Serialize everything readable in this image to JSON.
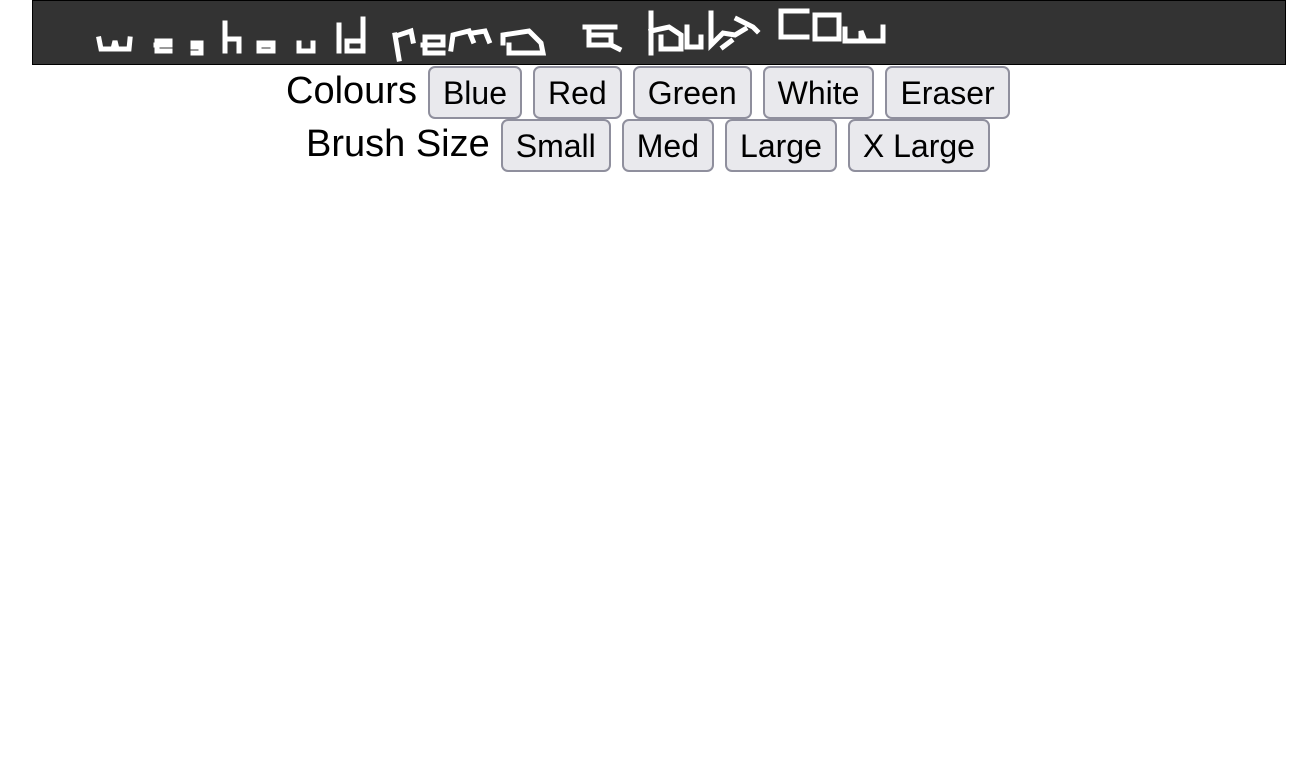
{
  "canvas": {
    "background": "#333333",
    "stroke_color": "#ffffff",
    "scribble_text": "we should name a baby cow"
  },
  "colours": {
    "label": "Colours",
    "buttons": [
      "Blue",
      "Red",
      "Green",
      "White",
      "Eraser"
    ]
  },
  "brush_size": {
    "label": "Brush Size",
    "buttons": [
      "Small",
      "Med",
      "Large",
      "X Large"
    ]
  }
}
